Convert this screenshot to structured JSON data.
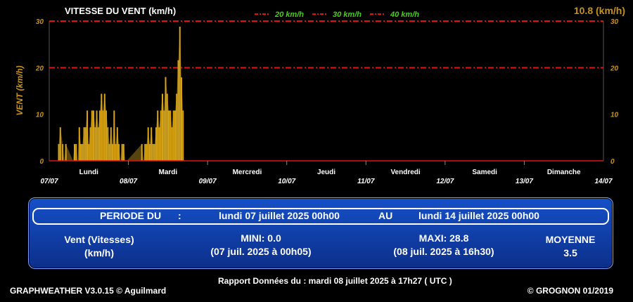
{
  "chart_data": {
    "type": "bar",
    "title": "VITESSE DU VENT (km/h)",
    "ylabel": "VENT (km/h)",
    "current_value": "10.8 (km/h)",
    "ylim": [
      0,
      30
    ],
    "yticks": [
      "0",
      "10",
      "20",
      "30"
    ],
    "xlim": [
      0,
      7
    ],
    "date_ticks": [
      "07/07",
      "08/07",
      "09/07",
      "10/07",
      "11/07",
      "12/07",
      "13/07",
      "14/07"
    ],
    "day_labels": [
      "Lundi",
      "Mardi",
      "Mercredi",
      "Jeudi",
      "Vendredi",
      "Samedi",
      "Dimanche"
    ],
    "legend": [
      {
        "label": "20 km/h",
        "value": 20
      },
      {
        "label": "30 km/h",
        "value": 30
      },
      {
        "label": "40 km/h",
        "value": 40
      }
    ],
    "colors": {
      "bars": "#d9a514",
      "fill": "#6b5410",
      "threshold": "#e01010",
      "axis_text": "#c8921a",
      "legend_text": "#4ccc1c"
    },
    "series": [
      {
        "x": [
          0.12,
          0.14,
          0.17,
          0.19,
          0.21,
          0.3,
          0.32,
          0.34,
          0.36,
          0.38,
          0.4,
          0.42,
          0.44,
          0.46,
          0.48,
          0.5,
          0.52,
          0.54,
          0.56,
          0.58,
          0.6,
          0.62,
          0.64,
          0.66,
          0.68,
          0.7,
          0.72,
          0.74,
          0.76,
          0.78,
          0.8,
          0.82,
          0.84,
          0.86,
          0.88,
          0.9,
          0.92,
          0.94,
          0.96,
          0.98,
          1.17,
          1.19,
          1.21,
          1.23,
          1.25,
          1.27,
          1.29,
          1.31,
          1.33,
          1.35,
          1.37,
          1.39,
          1.41,
          1.43,
          1.45,
          1.47,
          1.49,
          1.51,
          1.53,
          1.55,
          1.57,
          1.59,
          1.61,
          1.63,
          1.65,
          1.67,
          1.69
        ],
        "values": [
          3.6,
          7.2,
          3.6,
          0,
          3.6,
          0,
          3.6,
          3.6,
          0,
          7.2,
          3.6,
          3.6,
          7.2,
          7.2,
          10.8,
          3.6,
          7.2,
          10.8,
          10.8,
          7.2,
          10.8,
          7.2,
          10.8,
          14.4,
          10.8,
          14.4,
          10.8,
          7.2,
          3.6,
          7.2,
          3.6,
          10.8,
          3.6,
          7.2,
          3.6,
          0,
          3.6,
          3.6,
          0,
          0,
          3.6,
          0,
          3.6,
          3.6,
          7.2,
          3.6,
          7.2,
          3.6,
          3.6,
          7.2,
          10.8,
          7.2,
          10.8,
          14.4,
          10.8,
          18.0,
          14.4,
          10.8,
          10.8,
          7.2,
          10.8,
          10.8,
          14.4,
          21.6,
          28.8,
          17.9,
          10.8
        ]
      }
    ]
  },
  "panel": {
    "period_label": "PERIODE DU",
    "colon": ":",
    "start": "lundi 07 juillet 2025 00h00",
    "au": "AU",
    "end": "lundi 14 juillet 2025 00h00",
    "var_line1": "Vent (Vitesses)",
    "var_line2": "(km/h)",
    "mini_label": "MINI:  0.0",
    "mini_date": "(07 juil. 2025 à 00h05)",
    "maxi_label": "MAXI:  28.8",
    "maxi_date": "(08 juil. 2025 à 16h30)",
    "moyenne_label": "MOYENNE",
    "moyenne_value": "3.5"
  },
  "footer": {
    "left": "GRAPHWEATHER V3.0.15 © Aguilmard",
    "center": "Rapport Données du :  mardi 08 juillet 2025 à 17h27 ( UTC )",
    "right": "© GROGNON 01/2019"
  }
}
